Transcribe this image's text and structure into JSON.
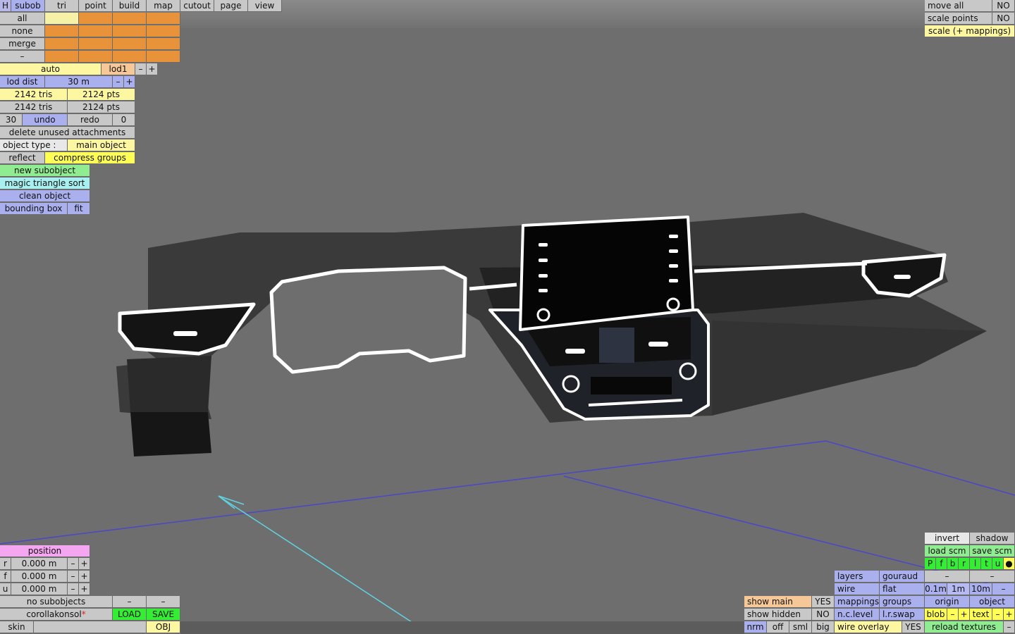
{
  "menu": {
    "h": "H",
    "items": [
      "subob",
      "tri",
      "point",
      "build",
      "map",
      "cutout",
      "page",
      "view"
    ]
  },
  "selection": {
    "all": "all",
    "none": "none",
    "merge": "merge",
    "dash": "–"
  },
  "lod": {
    "auto": "auto",
    "level": "lod1",
    "minus": "–",
    "plus": "+",
    "dist_label": "lod dist",
    "dist_value": "30 m"
  },
  "stats": {
    "tris1": "2142 tris",
    "pts1": "2124 pts",
    "tris2": "2142 tris",
    "pts2": "2124 pts"
  },
  "undo": {
    "count": "30",
    "undo_label": "undo",
    "redo_label": "redo",
    "redo_count": "0"
  },
  "tools": {
    "delete_unused": "delete unused attachments",
    "object_type_label": "object type :",
    "object_type_value": "main object",
    "reflect": "reflect",
    "compress_groups": "compress groups",
    "new_subobject": "new subobject",
    "magic_sort": "magic triangle sort",
    "clean_object": "clean object",
    "bounding_box": "bounding box",
    "fit": "fit"
  },
  "topright": {
    "move_all": "move all",
    "move_all_val": "NO",
    "scale_points": "scale points",
    "scale_points_val": "NO",
    "scale_mappings": "scale (+ mappings)"
  },
  "position": {
    "title": "position",
    "rows": [
      {
        "axis": "r",
        "value": "0.000 m"
      },
      {
        "axis": "f",
        "value": "0.000 m"
      },
      {
        "axis": "u",
        "value": "0.000 m"
      }
    ],
    "minus": "–",
    "plus": "+"
  },
  "file": {
    "no_subobjects": "no subobjects",
    "dash": "–",
    "filename": "corollakonsol",
    "modified_mark": "*",
    "load": "LOAD",
    "save": "SAVE",
    "skin": "skin",
    "obj": "OBJ"
  },
  "display": {
    "show_main": "show main",
    "show_main_val": "YES",
    "show_hidden": "show hidden",
    "show_hidden_val": "NO",
    "nrm": "nrm",
    "off": "off",
    "sml": "sml",
    "big": "big",
    "layers": "layers",
    "gouraud": "gouraud",
    "wire": "wire",
    "flat": "flat",
    "mappings": "mappings",
    "groups": "groups",
    "nc_level": "n.c.level",
    "lr_swap": "l.r.swap",
    "wire_overlay": "wire overlay",
    "wire_overlay_val": "YES"
  },
  "render": {
    "invert": "invert",
    "shadow": "shadow",
    "load_scm": "load scm",
    "save_scm": "save scm",
    "channels": [
      "P",
      "f",
      "b",
      "r",
      "l",
      "t",
      "u",
      "●"
    ],
    "dash": "–",
    "scale_01": "0.1m",
    "scale_1": "1m",
    "scale_10": "10m",
    "origin": "origin",
    "object": "object",
    "blob": "blob",
    "text": "text",
    "minus": "–",
    "plus": "+",
    "reload_textures": "reload textures"
  }
}
